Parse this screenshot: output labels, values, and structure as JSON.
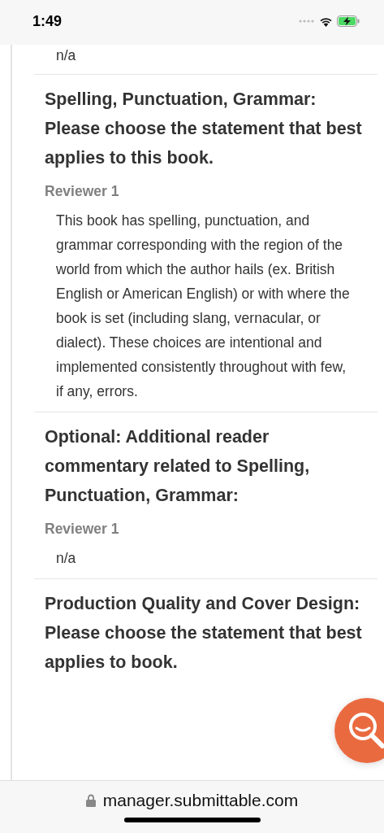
{
  "status_bar": {
    "time": "1:49"
  },
  "sections": [
    {
      "answer": "n/a"
    },
    {
      "question": "Spelling, Punctuation, Grammar: Please choose the statement that best applies to this book.",
      "reviewer": "Reviewer 1",
      "answer": "This book has spelling, punctuation, and grammar corresponding with the region of the world from which the author hails (ex. British English or American English) or with where the book is set (including slang, vernacular, or dialect). These choices are intentional and implemented consistently throughout with few, if any, errors."
    },
    {
      "question": "Optional: Additional reader commentary related to Spelling, Punctuation, Grammar:",
      "reviewer": "Reviewer 1",
      "answer": "n/a"
    },
    {
      "question": "Production Quality and Cover Design: Please choose the statement that best applies to book."
    }
  ],
  "address_bar": {
    "url": "manager.submittable.com"
  }
}
